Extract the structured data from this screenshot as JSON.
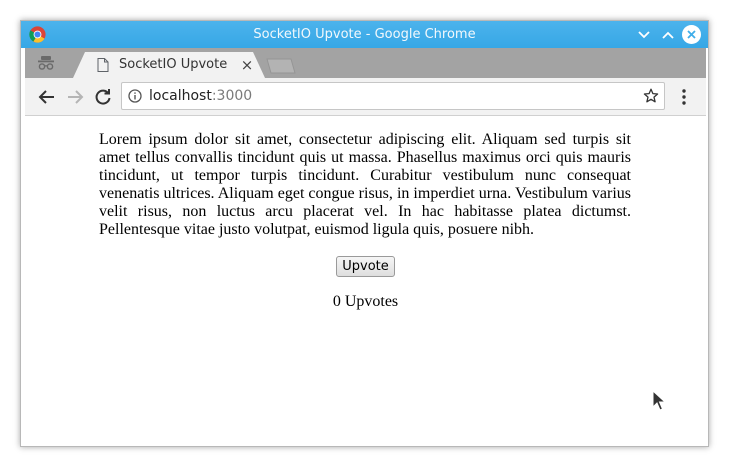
{
  "window": {
    "title": "SocketIO Upvote - Google Chrome"
  },
  "tab": {
    "title": "SocketIO Upvote",
    "close_label": "×"
  },
  "toolbar": {
    "url_host": "localhost",
    "url_port": ":3000"
  },
  "page": {
    "paragraph": "Lorem ipsum dolor sit amet, consectetur adipiscing elit. Aliquam sed turpis sit amet tellus convallis tincidunt quis ut massa. Phasellus maximus orci quis mauris tincidunt, ut tempor turpis tincidunt. Curabitur vestibulum nunc consequat venenatis ultrices. Aliquam eget congue risus, in imperdiet urna. Vestibulum varius velit risus, non luctus arcu placerat vel. In hac habitasse platea dictumst. Pellentesque vitae justo volutpat, euismod ligula quis, posuere nibh.",
    "upvote_button_label": "Upvote",
    "upvote_count_text": "0 Upvotes"
  },
  "colors": {
    "titlebar": "#3fade9",
    "tabstrip": "#a3a3a3",
    "toolbar": "#f2f2f2"
  },
  "icons": {
    "app": "chrome-logo-icon",
    "incognito": "incognito-icon",
    "page": "page-icon",
    "back": "back-arrow-icon",
    "forward": "forward-arrow-icon",
    "reload": "reload-icon",
    "info": "info-icon",
    "bookmark": "star-icon",
    "menu": "more-vert-icon",
    "cursor": "mouse-cursor-icon"
  }
}
